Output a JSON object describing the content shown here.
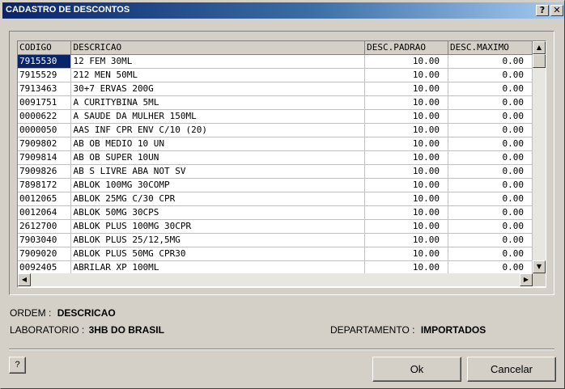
{
  "window": {
    "title": "CADASTRO DE DESCONTOS",
    "help_glyph": "?",
    "close_glyph": "✕"
  },
  "grid": {
    "columns": [
      "CODIGO",
      "DESCRICAO",
      "DESC.PADRAO",
      "DESC.MAXIMO"
    ],
    "rows": [
      {
        "codigo": "7915530",
        "descricao": "12 FEM 30ML",
        "padrao": "10.00",
        "maximo": "0.00"
      },
      {
        "codigo": "7915529",
        "descricao": "212 MEN 50ML",
        "padrao": "10.00",
        "maximo": "0.00"
      },
      {
        "codigo": "7913463",
        "descricao": "30+7 ERVAS 200G",
        "padrao": "10.00",
        "maximo": "0.00"
      },
      {
        "codigo": "0091751",
        "descricao": "A CURITYBINA 5ML",
        "padrao": "10.00",
        "maximo": "0.00"
      },
      {
        "codigo": "0000622",
        "descricao": "A SAUDE DA MULHER 150ML",
        "padrao": "10.00",
        "maximo": "0.00"
      },
      {
        "codigo": "0000050",
        "descricao": "AAS INF CPR ENV C/10 (20)",
        "padrao": "10.00",
        "maximo": "0.00"
      },
      {
        "codigo": "7909802",
        "descricao": "AB OB MEDIO 10 UN",
        "padrao": "10.00",
        "maximo": "0.00"
      },
      {
        "codigo": "7909814",
        "descricao": "AB OB SUPER 10UN",
        "padrao": "10.00",
        "maximo": "0.00"
      },
      {
        "codigo": "7909826",
        "descricao": "AB S LIVRE ABA NOT SV",
        "padrao": "10.00",
        "maximo": "0.00"
      },
      {
        "codigo": "7898172",
        "descricao": "ABLOK 100MG 30COMP",
        "padrao": "10.00",
        "maximo": "0.00"
      },
      {
        "codigo": "0012065",
        "descricao": "ABLOK 25MG C/30 CPR",
        "padrao": "10.00",
        "maximo": "0.00"
      },
      {
        "codigo": "0012064",
        "descricao": "ABLOK 50MG 30CPS",
        "padrao": "10.00",
        "maximo": "0.00"
      },
      {
        "codigo": "2612700",
        "descricao": "ABLOK PLUS 100MG 30CPR",
        "padrao": "10.00",
        "maximo": "0.00"
      },
      {
        "codigo": "7903040",
        "descricao": "ABLOK PLUS 25/12,5MG",
        "padrao": "10.00",
        "maximo": "0.00"
      },
      {
        "codigo": "7909020",
        "descricao": "ABLOK PLUS 50MG CPR30",
        "padrao": "10.00",
        "maximo": "0.00"
      },
      {
        "codigo": "0092405",
        "descricao": "ABRILAR XP 100ML",
        "padrao": "10.00",
        "maximo": "0.00"
      }
    ],
    "selected_row": 0
  },
  "info": {
    "ordem_label": "ORDEM :",
    "ordem_value": "DESCRICAO",
    "laboratorio_label": "LABORATORIO :",
    "laboratorio_value": "3HB DO BRASIL",
    "departamento_label": "DEPARTAMENTO :",
    "departamento_value": "IMPORTADOS"
  },
  "buttons": {
    "help": "?",
    "ok": "Ok",
    "cancel": "Cancelar"
  }
}
